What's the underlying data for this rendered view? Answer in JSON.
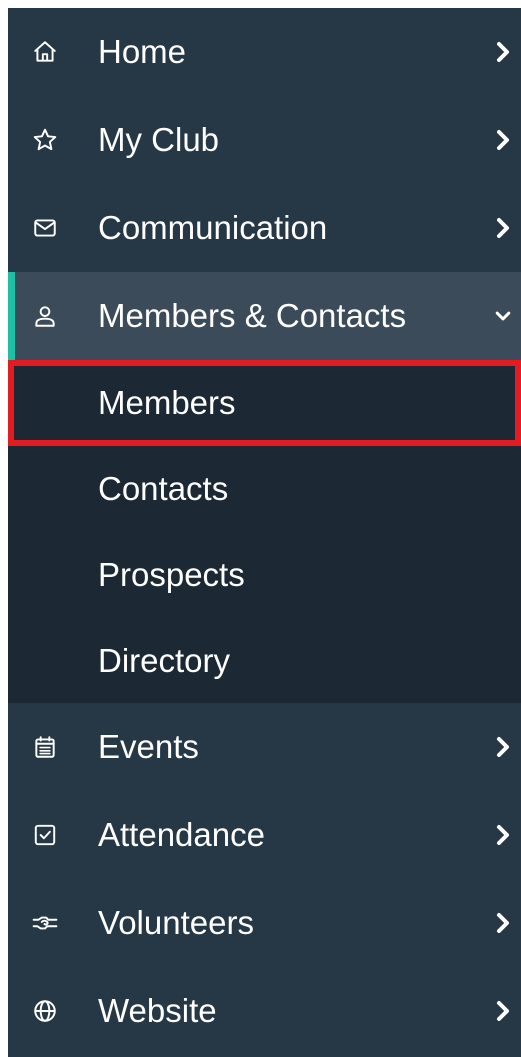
{
  "nav": {
    "items_before": [
      {
        "label": "Home",
        "icon": "home-icon"
      },
      {
        "label": "My Club",
        "icon": "star-icon"
      },
      {
        "label": "Communication",
        "icon": "mail-icon"
      }
    ],
    "expanded": {
      "label": "Members & Contacts",
      "icon": "user-icon"
    },
    "submenu": [
      {
        "label": "Members"
      },
      {
        "label": "Contacts"
      },
      {
        "label": "Prospects"
      },
      {
        "label": "Directory"
      }
    ],
    "items_after": [
      {
        "label": "Events",
        "icon": "calendar-icon"
      },
      {
        "label": "Attendance",
        "icon": "checkbox-icon"
      },
      {
        "label": "Volunteers",
        "icon": "handshake-icon"
      },
      {
        "label": "Website",
        "icon": "globe-icon"
      }
    ]
  },
  "colors": {
    "sidebar_bg": "#263746",
    "active_bg": "#3b4b59",
    "submenu_bg": "#1c2935",
    "accent": "#1fbfa6",
    "highlight_border": "#e31b23"
  }
}
